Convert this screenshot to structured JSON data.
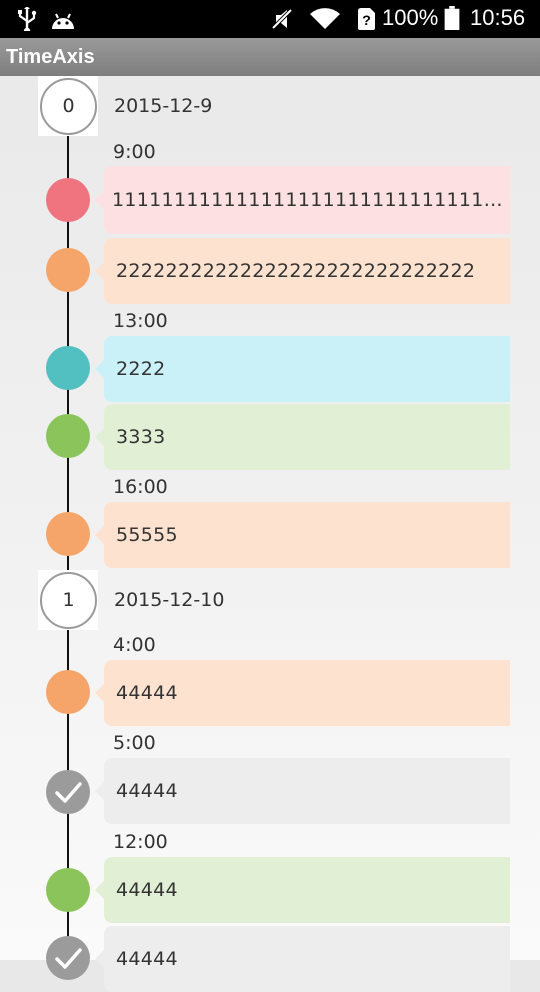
{
  "status_bar": {
    "battery": "100%",
    "time": "10:56",
    "icons": [
      "usb-icon",
      "android-debug-icon",
      "mute-icon",
      "wifi-icon",
      "sim-unknown-icon",
      "battery-icon"
    ]
  },
  "app_bar": {
    "title": "TimeAxis"
  },
  "colors": {
    "pink_dot": "#ef7480",
    "pink_bg": "#fde0e2",
    "orange_dot": "#f5a56a",
    "orange_bg": "#fde2cf",
    "teal_dot": "#52bfc0",
    "teal_bg": "#c9f1f7",
    "green_dot": "#8bc45a",
    "green_bg": "#e1f0d5",
    "gray_dot": "#9b9b9b",
    "gray_bg": "#ededed"
  },
  "days": [
    {
      "index": "0",
      "date": "2015-12-9"
    },
    {
      "index": "1",
      "date": "2015-12-10"
    }
  ],
  "times": [
    "9:00",
    "13:00",
    "16:00",
    "4:00",
    "5:00",
    "12:00"
  ],
  "entries": [
    {
      "text": "1111111111111111111111111111111111111",
      "color": "pink"
    },
    {
      "text": "22222222222222222222222222222",
      "color": "orange"
    },
    {
      "text": "2222",
      "color": "teal"
    },
    {
      "text": "3333",
      "color": "green"
    },
    {
      "text": "55555",
      "color": "orange"
    },
    {
      "text": "44444",
      "color": "orange"
    },
    {
      "text": "44444",
      "color": "gray",
      "done": true
    },
    {
      "text": "44444",
      "color": "green"
    },
    {
      "text": "44444",
      "color": "gray",
      "done": true
    }
  ]
}
